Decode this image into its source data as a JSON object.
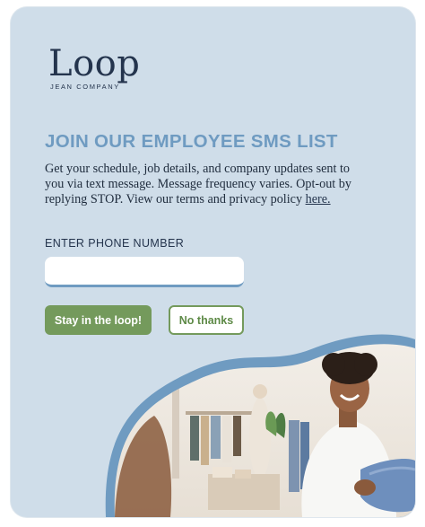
{
  "brand": {
    "name": "Loop",
    "tagline": "JEAN COMPANY"
  },
  "signup": {
    "title": "JOIN OUR EMPLOYEE SMS LIST",
    "description": "Get your schedule, job details, and company updates sent to you via text message. Message frequency varies. Opt-out by replying STOP. View our terms and privacy policy",
    "link_text": "here.",
    "phone_label": "ENTER PHONE NUMBER",
    "phone_value": "",
    "phone_placeholder": ""
  },
  "buttons": {
    "accept": "Stay in the loop!",
    "decline": "No thanks"
  },
  "colors": {
    "card_background": "#cfdde9",
    "title": "#6f9bc1",
    "accent_green": "#749a5c",
    "brand_navy": "#24344d"
  },
  "image": {
    "description_icon": "store-photo"
  }
}
